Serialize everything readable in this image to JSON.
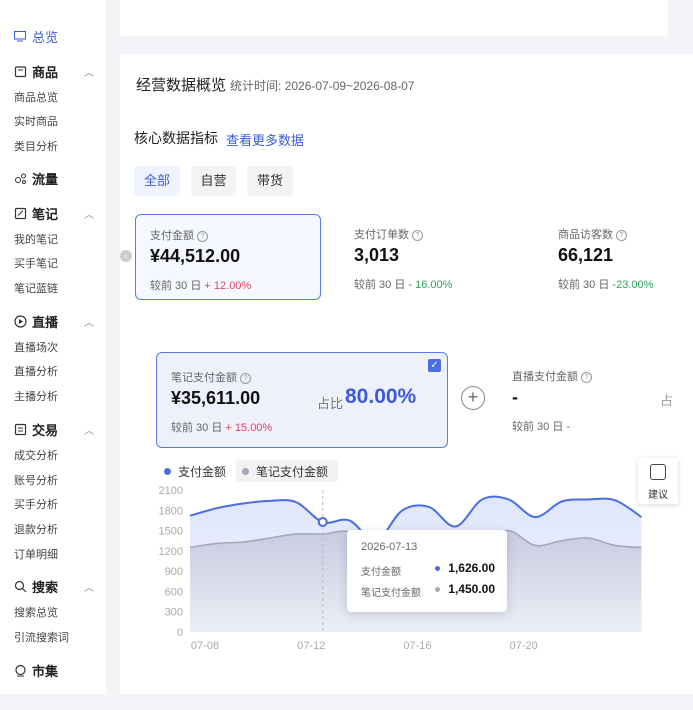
{
  "sidebar": {
    "active": {
      "label": "总览",
      "icon": "monitor-icon"
    },
    "groups": [
      {
        "label": "商品",
        "icon": "product-icon",
        "items": [
          "商品总览",
          "实时商品",
          "类目分析"
        ]
      },
      {
        "label": "流量",
        "icon": "traffic-icon",
        "items": []
      },
      {
        "label": "笔记",
        "icon": "note-icon",
        "items": [
          "我的笔记",
          "买手笔记",
          "笔记蓝链"
        ]
      },
      {
        "label": "直播",
        "icon": "live-icon",
        "items": [
          "直播场次",
          "直播分析",
          "主播分析"
        ]
      },
      {
        "label": "交易",
        "icon": "trade-icon",
        "items": [
          "成交分析",
          "账号分析",
          "买手分析",
          "退款分析",
          "订单明细"
        ]
      },
      {
        "label": "搜索",
        "icon": "search-icon",
        "items": [
          "搜索总览",
          "引流搜索词"
        ]
      },
      {
        "label": "市集",
        "icon": "market-icon",
        "items": []
      }
    ]
  },
  "overview": {
    "title": "经营数据概览",
    "time_label": "统计时间:",
    "time_range": "2026-07-09~2026-08-07",
    "core_title": "核心数据指标",
    "more_link": "查看更多数据",
    "tabs": [
      "全部",
      "自营",
      "带货"
    ]
  },
  "metrics": [
    {
      "label": "支付金额",
      "value": "¥44,512.00",
      "cmp_prefix": "较前 30 日",
      "change": "+ 12.00%",
      "trend": "up"
    },
    {
      "label": "支付订单数",
      "value": "3,013",
      "cmp_prefix": "较前 30 日",
      "change": "- 16.00%",
      "trend": "down"
    },
    {
      "label": "商品访客数",
      "value": "66,121",
      "cmp_prefix": "较前 30 日",
      "change": "-23.00%",
      "trend": "down"
    }
  ],
  "breakdown": {
    "note_card": {
      "label": "笔记支付金额",
      "value": "¥35,611.00",
      "cmp_prefix": "较前 30 日",
      "change": "+ 15.00%",
      "ratio_label": "占比",
      "ratio": "80.00%"
    },
    "live_card": {
      "label": "直播支付金额",
      "value": "-",
      "cmp_prefix": "较前 30 日",
      "change": "-",
      "edge": "占"
    }
  },
  "side_tip": {
    "label": "建议"
  },
  "tooltip": {
    "date": "2026-07-13",
    "rows": [
      {
        "label": "支付金额",
        "value": "1,626.00"
      },
      {
        "label": "笔记支付金额",
        "value": "1,450.00"
      }
    ]
  },
  "colors": {
    "accent": "#3b5bdb",
    "series_primary": "#4a6ee0",
    "series_secondary": "#a3a8bd",
    "up": "#e0455e",
    "down": "#2da35a"
  },
  "chart_data": {
    "type": "area",
    "x_tick_labels": [
      "07-08",
      "07-12",
      "07-16",
      "07-20"
    ],
    "y_ticks": [
      0,
      300,
      600,
      900,
      1200,
      1500,
      1800,
      2100
    ],
    "ylim": [
      0,
      2100
    ],
    "series": [
      {
        "name": "支付金额",
        "points": [
          [
            0,
            1720
          ],
          [
            1,
            1830
          ],
          [
            2,
            1900
          ],
          [
            3,
            1940
          ],
          [
            4,
            1920
          ],
          [
            5,
            1626
          ],
          [
            6,
            1650
          ],
          [
            7,
            1350
          ],
          [
            8,
            1800
          ],
          [
            9,
            1850
          ],
          [
            10,
            1560
          ],
          [
            11,
            1960
          ],
          [
            12,
            1960
          ],
          [
            13,
            1700
          ],
          [
            14,
            1930
          ],
          [
            15,
            1960
          ],
          [
            16,
            1950
          ],
          [
            17,
            1700
          ]
        ]
      },
      {
        "name": "笔记支付金额",
        "points": [
          [
            0,
            1250
          ],
          [
            1,
            1310
          ],
          [
            2,
            1330
          ],
          [
            3,
            1390
          ],
          [
            4,
            1450
          ],
          [
            5,
            1450
          ],
          [
            6,
            1480
          ],
          [
            7,
            1250
          ],
          [
            8,
            1360
          ],
          [
            9,
            1410
          ],
          [
            10,
            1260
          ],
          [
            11,
            1370
          ],
          [
            12,
            1500
          ],
          [
            13,
            1280
          ],
          [
            14,
            1350
          ],
          [
            15,
            1390
          ],
          [
            16,
            1280
          ],
          [
            17,
            1250
          ]
        ]
      }
    ],
    "x_tick_index": [
      0,
      4,
      8,
      12
    ],
    "highlight_index": 5,
    "x_domain": [
      0,
      18
    ]
  }
}
